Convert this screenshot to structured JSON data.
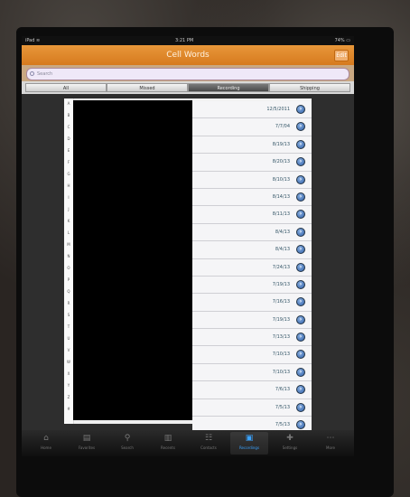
{
  "status": {
    "carrier": "iPad ≋",
    "time": "3:21 PM",
    "battery": "74% ▭"
  },
  "nav": {
    "title": "Cell Words",
    "right_button": "Edit"
  },
  "search": {
    "placeholder": "Search"
  },
  "segments": [
    {
      "label": "All",
      "active": false
    },
    {
      "label": "Missed",
      "active": false
    },
    {
      "label": "Recording",
      "active": true
    },
    {
      "label": "Shipping",
      "active": false
    }
  ],
  "index_letters": [
    "A",
    "B",
    "C",
    "D",
    "E",
    "F",
    "G",
    "H",
    "I",
    "J",
    "K",
    "L",
    "M",
    "N",
    "O",
    "P",
    "Q",
    "R",
    "S",
    "T",
    "U",
    "V",
    "W",
    "X",
    "Y",
    "Z",
    "#"
  ],
  "rows": [
    "12/5/2011",
    "7/7/04",
    "8/19/13",
    "8/20/13",
    "8/10/13",
    "8/14/13",
    "8/11/13",
    "8/4/13",
    "8/4/13",
    "7/24/13",
    "7/19/13",
    "7/16/13",
    "7/19/13",
    "7/13/13",
    "7/10/13",
    "7/10/13",
    "7/6/13",
    "7/5/13",
    "7/5/13"
  ],
  "tabs": [
    {
      "icon": "home-icon",
      "glyph": "⌂",
      "label": "Home",
      "active": false
    },
    {
      "icon": "favorites-icon",
      "glyph": "▤",
      "label": "Favorites",
      "active": false
    },
    {
      "icon": "search-icon",
      "glyph": "⚲",
      "label": "Search",
      "active": false
    },
    {
      "icon": "recents-icon",
      "glyph": "▥",
      "label": "Recents",
      "active": false
    },
    {
      "icon": "contacts-icon",
      "glyph": "☷",
      "label": "Contacts",
      "active": false
    },
    {
      "icon": "recordings-icon",
      "glyph": "▣",
      "label": "Recordings",
      "active": true
    },
    {
      "icon": "settings-icon",
      "glyph": "✚",
      "label": "Settings",
      "active": false
    },
    {
      "icon": "more-icon",
      "glyph": "⋯",
      "label": "More",
      "active": false
    }
  ],
  "colors": {
    "nav": "#e08a2a",
    "accent": "#3aa3ff"
  }
}
